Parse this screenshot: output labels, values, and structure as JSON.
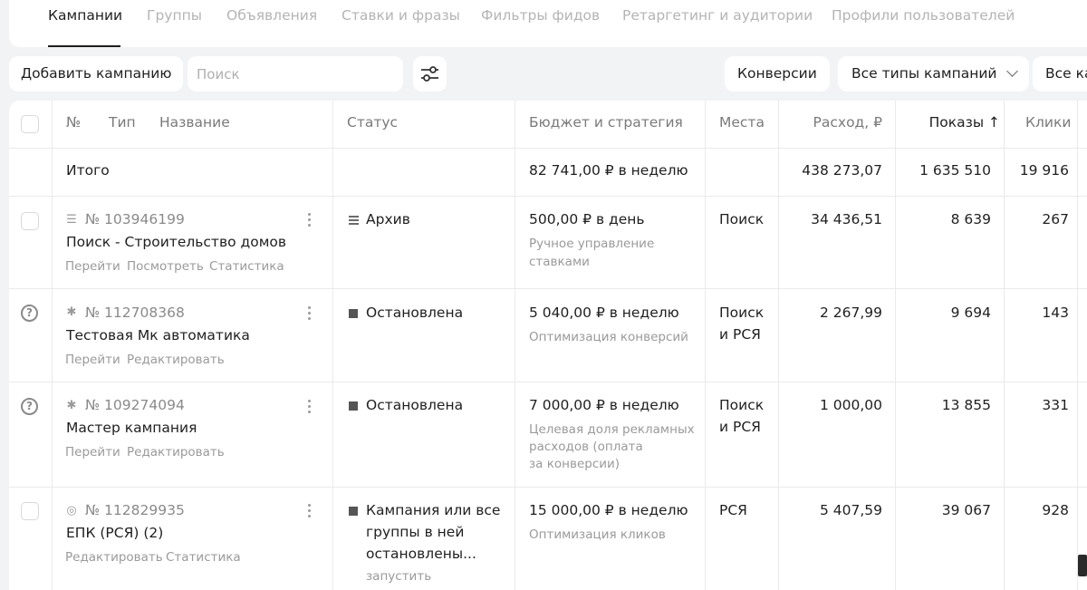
{
  "tabs": [
    {
      "label": "Кампании",
      "active": true
    },
    {
      "label": "Группы",
      "active": false
    },
    {
      "label": "Объявления",
      "active": false
    },
    {
      "label": "Ставки и фразы",
      "active": false
    },
    {
      "label": "Фильтры фидов",
      "active": false
    },
    {
      "label": "Ретаргетинг и аудитории",
      "active": false
    },
    {
      "label": "Профили пользователей",
      "active": false
    }
  ],
  "toolbar": {
    "add_label": "Добавить кампанию",
    "search_placeholder": "Поиск",
    "filter_icon": "sliders-icon",
    "conversions_label": "Конверсии",
    "types_label": "Все типы кампаний",
    "all_label": "Все ка"
  },
  "table": {
    "headers": {
      "num": "№",
      "type": "Тип",
      "name": "Название",
      "status": "Статус",
      "budget": "Бюджет и стратегия",
      "places": "Места",
      "spend": "Расход, ₽",
      "impressions": "Показы ↑",
      "clicks": "Клики"
    },
    "total": {
      "label": "Итого",
      "budget": "82 741,00 ₽ в неделю",
      "spend": "438 273,07",
      "impressions": "1 635 510",
      "clicks": "19 916"
    },
    "rows": [
      {
        "id": "№ 103946199",
        "name": "Поиск - Строительство домов",
        "links": [
          "Перейти",
          "Посмотреть",
          "Статистика"
        ],
        "status": "Архив",
        "budget": "500,00 ₽ в день",
        "strategy": [
          "Ручное управление",
          "ставками"
        ],
        "places": [
          "Поиск"
        ],
        "spend": "34 436,51",
        "impressions": "8 639",
        "clicks": "267"
      },
      {
        "id": "№ 112708368",
        "name": "Тестовая Мк автоматика",
        "links": [
          "Перейти",
          "Редактировать"
        ],
        "status": "Остановлена",
        "budget": "5 040,00 ₽ в неделю",
        "strategy": [
          "Оптимизация конверсий"
        ],
        "places": [
          "Поиск",
          "и РСЯ"
        ],
        "spend": "2 267,99",
        "impressions": "9 694",
        "clicks": "143"
      },
      {
        "id": "№ 109274094",
        "name": "Мастер кампания",
        "links": [
          "Перейти",
          "Редактировать"
        ],
        "status": "Остановлена",
        "budget": "7 000,00 ₽ в неделю",
        "strategy": [
          "Целевая доля рекламных",
          "расходов (оплата",
          "за конверсии)"
        ],
        "places": [
          "Поиск",
          "и РСЯ"
        ],
        "spend": "1 000,00",
        "impressions": "13 855",
        "clicks": "331"
      },
      {
        "id": "№ 112829935",
        "name": "ЕПК (РСЯ) (2)",
        "links": [
          "Редактировать",
          "Статистика"
        ],
        "status_lines": [
          "Кампания или все",
          "группы в ней",
          "остановлены..."
        ],
        "status_action": "запустить",
        "budget": "15 000,00 ₽ в неделю",
        "strategy": [
          "Оптимизация кликов"
        ],
        "places": [
          "РСЯ"
        ],
        "spend": "5 407,59",
        "impressions": "39 067",
        "clicks": "928"
      }
    ]
  }
}
